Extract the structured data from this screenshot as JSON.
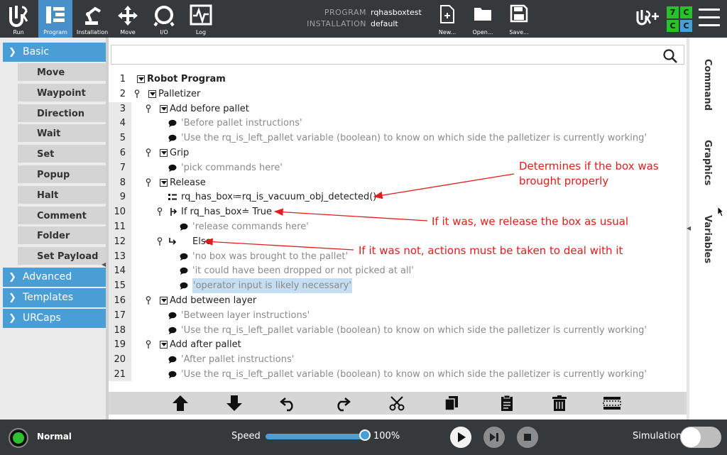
{
  "topbar": {
    "tabs": [
      {
        "label": "Run",
        "icon": "ur-logo-icon"
      },
      {
        "label": "Program",
        "icon": "program-icon",
        "active": true
      },
      {
        "label": "Installation",
        "icon": "robot-arm-icon"
      },
      {
        "label": "Move",
        "icon": "move-arrows-icon"
      },
      {
        "label": "I/O",
        "icon": "io-icon"
      },
      {
        "label": "Log",
        "icon": "log-icon"
      }
    ],
    "program_key": "PROGRAM",
    "program_value": "rqhasboxtest",
    "installation_key": "INSTALLATION",
    "installation_value": "default",
    "file_buttons": [
      {
        "label": "New...",
        "icon": "new-file-icon"
      },
      {
        "label": "Open...",
        "icon": "open-folder-icon"
      },
      {
        "label": "Save...",
        "icon": "save-disk-icon"
      }
    ],
    "safety_checksum": [
      "7",
      "C",
      "C",
      "C"
    ],
    "safety_colors": [
      "#27c227",
      "#27c227",
      "#27c227",
      "#4a9ed6"
    ]
  },
  "sidebar": {
    "basic_label": "Basic",
    "basic_items": [
      "Move",
      "Waypoint",
      "Direction",
      "Wait",
      "Set",
      "Popup",
      "Halt",
      "Comment",
      "Folder",
      "Set Payload"
    ],
    "sections": [
      "Advanced",
      "Templates",
      "URCaps"
    ]
  },
  "tree": {
    "lines": [
      {
        "n": "1",
        "text": "Robot Program",
        "kind": "bold"
      },
      {
        "n": "2",
        "text": "Palletizer",
        "kind": "plain"
      },
      {
        "n": "3",
        "text": "Add before pallet",
        "kind": "plain"
      },
      {
        "n": "4",
        "text": "'Before pallet instructions'",
        "kind": "comment"
      },
      {
        "n": "5",
        "text": "'Use the rq_is_left_pallet variable (boolean) to know on which side the palletizer is currently working'",
        "kind": "comment"
      },
      {
        "n": "6",
        "text": "Grip",
        "kind": "plain"
      },
      {
        "n": "7",
        "text": "'pick commands here'",
        "kind": "comment"
      },
      {
        "n": "8",
        "text": "Release",
        "kind": "plain"
      },
      {
        "n": "9",
        "text": "rq_has_box≔rq_is_vacuum_obj_detected()",
        "kind": "plain"
      },
      {
        "n": "10",
        "text": "If rq_has_box≐ True",
        "kind": "plain"
      },
      {
        "n": "11",
        "text": "'release commands here'",
        "kind": "comment"
      },
      {
        "n": "12",
        "text": "Else",
        "kind": "plain"
      },
      {
        "n": "13",
        "text": "'no box was brought to the pallet'",
        "kind": "comment"
      },
      {
        "n": "14",
        "text": "'it could have been dropped or not picked at all'",
        "kind": "comment"
      },
      {
        "n": "15",
        "text": "'operator input is likely necessary'",
        "kind": "comment"
      },
      {
        "n": "16",
        "text": "Add between layer",
        "kind": "plain"
      },
      {
        "n": "17",
        "text": "'Between layer instructions'",
        "kind": "comment"
      },
      {
        "n": "18",
        "text": "'Use the rq_is_left_pallet variable (boolean) to know on which side the palletizer is currently working'",
        "kind": "comment"
      },
      {
        "n": "19",
        "text": "Add after pallet",
        "kind": "plain"
      },
      {
        "n": "20",
        "text": "'After pallet instructions'",
        "kind": "comment"
      },
      {
        "n": "21",
        "text": "'Use the rq_is_left_pallet variable (boolean) to know on which side the palletizer is currently working'",
        "kind": "comment"
      }
    ]
  },
  "annotations": {
    "a1_line1": "Determines if the box was",
    "a1_line2": "brought properly",
    "a2": "If it was, we release the box as usual",
    "a3": "If it was not, actions must be taken to deal with it"
  },
  "rightbar": {
    "tabs": [
      "Command",
      "Graphics",
      "Variables"
    ]
  },
  "footer": {
    "status": "Normal",
    "speed_label": "Speed",
    "speed_value": "100%",
    "speed_fraction": 1.0,
    "simulation_label": "Simulation"
  }
}
